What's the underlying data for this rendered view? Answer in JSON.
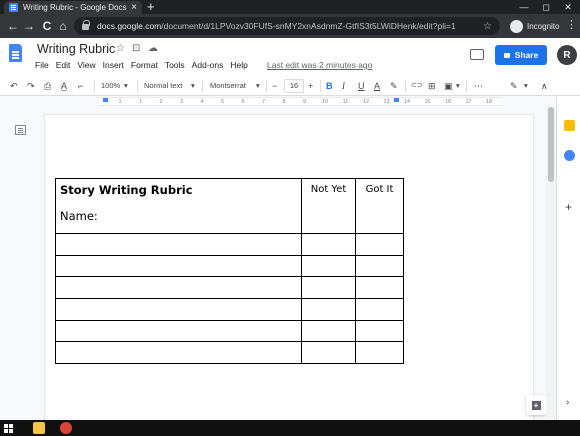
{
  "browser": {
    "tab_title": "Writing Rubric - Google Docs",
    "tab_close": "×",
    "new_tab": "+",
    "url_host": "docs.google.com",
    "url_path": "/document/d/1LPVozv30FUfS-snMY2xnAsdnmZ-GtfIS3t5LWiDHenk/edit?pli=1",
    "profile_label": "Incognito",
    "back": "←",
    "forward": "→",
    "reload": "C",
    "home": "⌂",
    "star": "☆",
    "menu": "⋮",
    "minimize": "—",
    "maximize": "◻",
    "close": "✕"
  },
  "docs": {
    "title": "Writing Rubric",
    "star_icon": "☆",
    "move_icon": "⊡",
    "cloud_icon": "☁",
    "menu": [
      "File",
      "Edit",
      "View",
      "Insert",
      "Format",
      "Tools",
      "Add-ons",
      "Help"
    ],
    "last_edit": "Last edit was 2 minutes ago",
    "share_label": "Share",
    "avatar_initial": "R"
  },
  "toolbar": {
    "undo": "↶",
    "redo": "↷",
    "print": "⎙",
    "spellcheck": "A̲",
    "paint_format": "⌐",
    "zoom": "100%",
    "style": "Normal text",
    "font": "Montserrat",
    "font_size": "16",
    "minus": "−",
    "plus": "+",
    "bold": "B",
    "italic": "I",
    "underline": "U",
    "text_color": "A",
    "highlight": "✎",
    "link": "⊂⊃",
    "comment": "⊞",
    "image": "▣",
    "more": "⋯",
    "editing": "✎",
    "collapse": "∧",
    "caret": "▾"
  },
  "ruler": {
    "numbers": [
      "1",
      "1",
      "2",
      "3",
      "4",
      "5",
      "6",
      "7",
      "8",
      "9",
      "10",
      "11",
      "12",
      "13",
      "14",
      "15",
      "16",
      "17",
      "18"
    ]
  },
  "document": {
    "rubric_title": "Story Writing Rubric",
    "name_label": "Name:",
    "col_not_yet": "Not Yet",
    "col_got_it": "Got It",
    "body_rows": 6
  },
  "side_panel": {
    "plus": "+",
    "expand": "›"
  },
  "colors": {
    "accent": "#1a73e8",
    "keep_yellow": "#fbbc04",
    "tasks_blue": "#4285f4"
  }
}
